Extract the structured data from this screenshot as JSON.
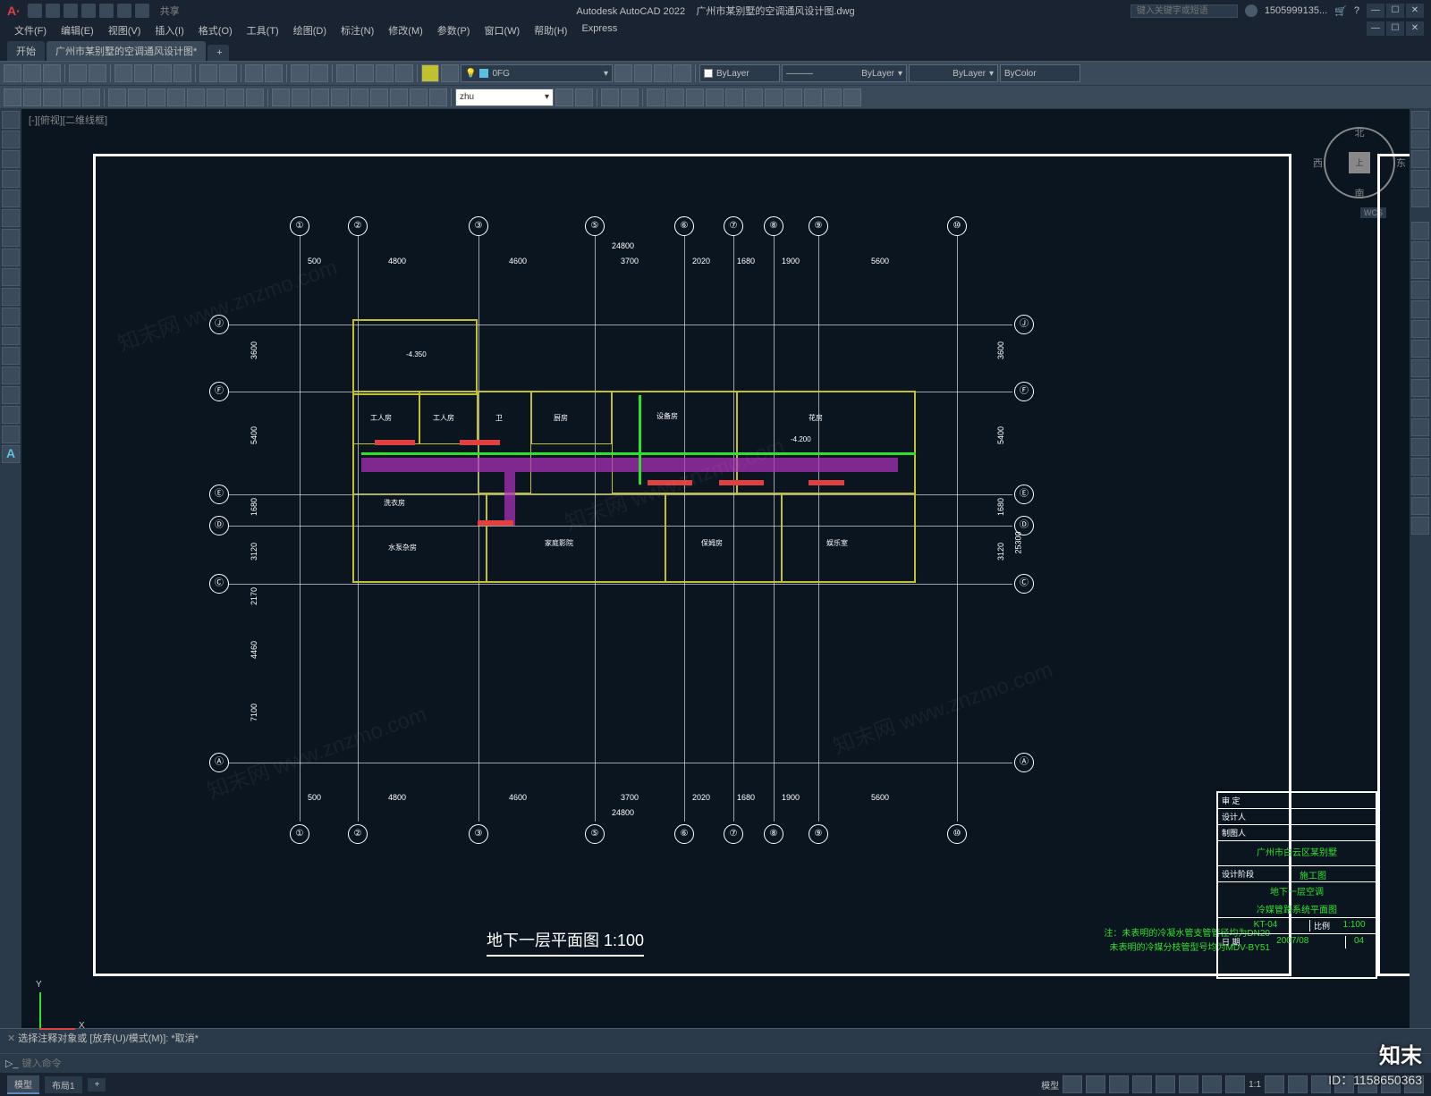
{
  "app": {
    "name": "Autodesk AutoCAD 2022",
    "file": "广州市某别墅的空调通风设计图.dwg"
  },
  "title_right": {
    "search_ph": "键入关键字或短语",
    "user": "1505999135...",
    "share": "共享"
  },
  "menus": [
    "文件(F)",
    "编辑(E)",
    "视图(V)",
    "插入(I)",
    "格式(O)",
    "工具(T)",
    "绘图(D)",
    "标注(N)",
    "修改(M)",
    "参数(P)",
    "窗口(W)",
    "帮助(H)",
    "Express"
  ],
  "tab_start": "开始",
  "doc_tab": "广州市某别墅的空调通风设计图*",
  "layer": {
    "current": "0FG",
    "bylayer": "ByLayer",
    "bycolor": "ByColor"
  },
  "text_style": "zhu",
  "view_label": "[-][俯视][二维线框]",
  "nav": {
    "n": "北",
    "s": "南",
    "e": "东",
    "w": "西",
    "top": "上",
    "wcs": "WCS"
  },
  "grid": {
    "cols": [
      "①",
      "②",
      "③",
      "⑤",
      "⑥",
      "⑦",
      "⑧",
      "⑨",
      "⑩"
    ],
    "rows": [
      "Ⓙ",
      "Ⓕ",
      "Ⓔ",
      "Ⓓ",
      "Ⓒ",
      "Ⓐ"
    ],
    "h_dims": [
      "500",
      "4800",
      "4600",
      "3700",
      "2020",
      "1680",
      "1900",
      "5600"
    ],
    "total_h": "24800",
    "v_dims": [
      "3600",
      "5400",
      "1680",
      "3120",
      "2170",
      "4460",
      "7100"
    ],
    "total_v": "25300"
  },
  "rooms": [
    "工人房",
    "工人房",
    "卫",
    "厨房",
    "设备房",
    "花房",
    "洗衣房",
    "家庭影院",
    "保姆房",
    "娱乐室",
    "水泵杂房"
  ],
  "elev1": "-4.350",
  "elev2": "-4.200",
  "plan_title": "地下一层平面图   1:100",
  "notes": {
    "l1": "注：未表明的冷凝水管支管管径均为DN20",
    "l2": "未表明的冷媒分枝管型号均为MDV-BY51"
  },
  "title_block": {
    "approve": "审 定",
    "designer": "设计人",
    "drafter": "制图人",
    "project": "广州市白云区某别墅",
    "stage_lbl": "设计阶段",
    "stage": "施工图",
    "dwg_name1": "地下一层空调",
    "dwg_name2": "冷媒管路系统平面图",
    "dwg_no": "KT-04",
    "scale_lbl": "比例",
    "scale": "1:100",
    "date_lbl": "日 期",
    "date": "2007/08",
    "sheet": "04"
  },
  "ucs": {
    "x": "X",
    "y": "Y"
  },
  "cmd": {
    "history": "选择注释对象或 [放弃(U)/模式(M)]: *取消*",
    "placeholder": "键入命令"
  },
  "status": {
    "model": "模型",
    "layout": "布局1",
    "scale": "1:1"
  },
  "watermark": {
    "brand": "知末",
    "id": "ID：1158650363",
    "wm": "知末网 www.znzmo.com"
  }
}
